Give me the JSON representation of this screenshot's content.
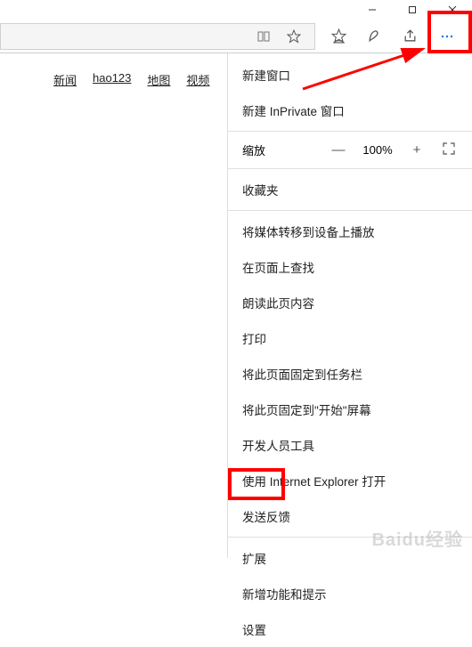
{
  "window": {
    "minimize": "—",
    "maximize": "❐",
    "close": "✕"
  },
  "nav": {
    "news": "新闻",
    "hao123": "hao123",
    "map": "地图",
    "video": "视频"
  },
  "menu": {
    "new_window": "新建窗口",
    "new_inprivate": "新建 InPrivate 窗口",
    "zoom_label": "缩放",
    "zoom_minus": "—",
    "zoom_value": "100%",
    "zoom_plus": "+",
    "zoom_full": "⛶",
    "favorites": "收藏夹",
    "cast": "将媒体转移到设备上播放",
    "find": "在页面上查找",
    "read_aloud": "朗读此页内容",
    "print": "打印",
    "pin_taskbar": "将此页面固定到任务栏",
    "pin_start": "将此页固定到\"开始\"屏幕",
    "dev_tools": "开发人员工具",
    "open_ie": "使用 Internet Explorer 打开",
    "feedback": "发送反馈",
    "extensions": "扩展",
    "whats_new": "新增功能和提示",
    "settings": "设置"
  },
  "watermark": "Baidu经验"
}
